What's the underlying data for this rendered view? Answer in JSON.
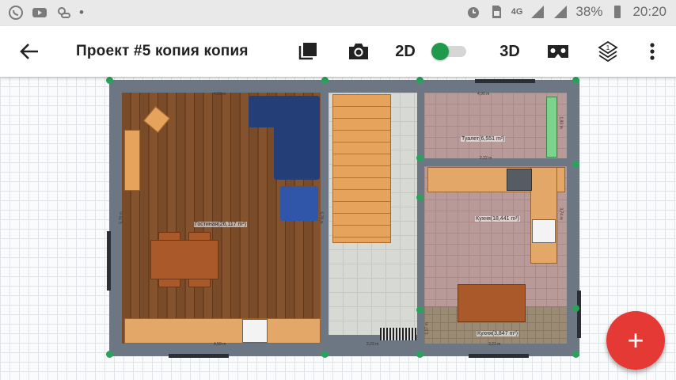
{
  "status_bar": {
    "network": "4G",
    "battery": "38%",
    "time": "20:20"
  },
  "app_bar": {
    "title": "Проект #5 копия копия",
    "mode_2d": "2D",
    "mode_3d": "3D",
    "layers_count": "1"
  },
  "plan": {
    "rooms": [
      {
        "name": "Гостиная(26,117 m²)"
      },
      {
        "name": "Туалет(6,551 m²)"
      },
      {
        "name": "Кухня(18,441 m²)"
      },
      {
        "name": "Кухня(3,847 m²)"
      }
    ],
    "dimensions": {
      "living_top": "4,59 m",
      "living_bottom": "4,59 m",
      "living_side": "5,78 m",
      "stairs_side": "5,78 m",
      "hall_bottom": "2,23 m",
      "toilet_top": "4,90 m",
      "toilet_inner": "2,22 m",
      "toilet_side": "1,83 m",
      "kitchen_bottom": "3,21 m",
      "kitchen_side": "3,74 m",
      "bottom_right_side": "1,17 m"
    }
  },
  "colors": {
    "accent_fab": "#e53935",
    "toggle_on": "#1f9a4c",
    "wall": "#6c7783"
  },
  "fab": {
    "label": "+"
  }
}
